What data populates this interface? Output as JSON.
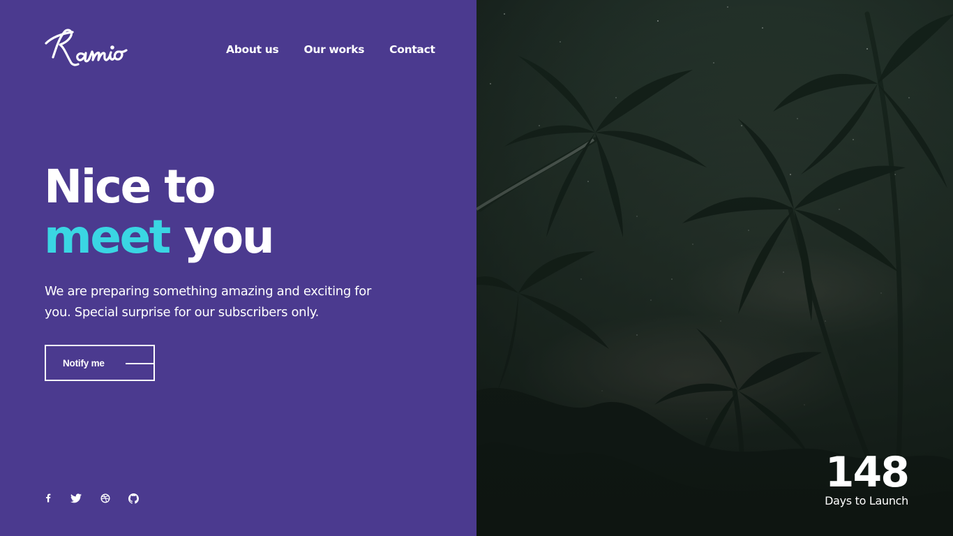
{
  "brand": {
    "logo_text": "Ramio"
  },
  "nav": {
    "items": [
      {
        "label": "About us"
      },
      {
        "label": "Our works"
      },
      {
        "label": "Contact"
      }
    ]
  },
  "hero": {
    "title_line1": "Nice to",
    "title_accent": "meet",
    "title_rest": "you",
    "description": "We are preparing something amazing and exciting for you. Special surprise for our subscribers only.",
    "cta_label": "Notify me"
  },
  "social": {
    "icons": [
      "facebook-icon",
      "twitter-icon",
      "dribbble-icon",
      "github-icon"
    ]
  },
  "countdown": {
    "days": "148",
    "label": "Days to Launch"
  },
  "colors": {
    "panel_bg": "#4b3a8f",
    "accent": "#3ad6e3",
    "text": "#ffffff"
  }
}
